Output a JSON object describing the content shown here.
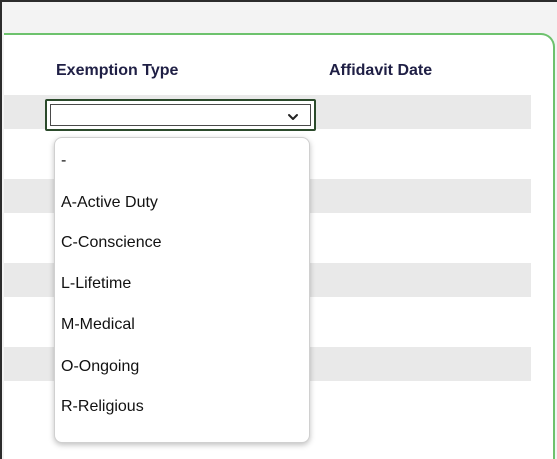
{
  "table": {
    "columns": {
      "exemption_type": "Exemption Type",
      "affidavit_date": "Affidavit Date"
    }
  },
  "exemption_select": {
    "selected_value": "",
    "options": [
      "-",
      "A-Active Duty",
      "C-Conscience",
      "L-Lifetime",
      "M-Medical",
      "O-Ongoing",
      "R-Religious"
    ]
  },
  "icons": {
    "select_arrow": "chevron-down-icon"
  },
  "colors": {
    "panel_border": "#6dc26d",
    "header_text": "#1f1f45",
    "row_stripe": "#e9e9e9",
    "select_border": "#2b4a2b"
  }
}
